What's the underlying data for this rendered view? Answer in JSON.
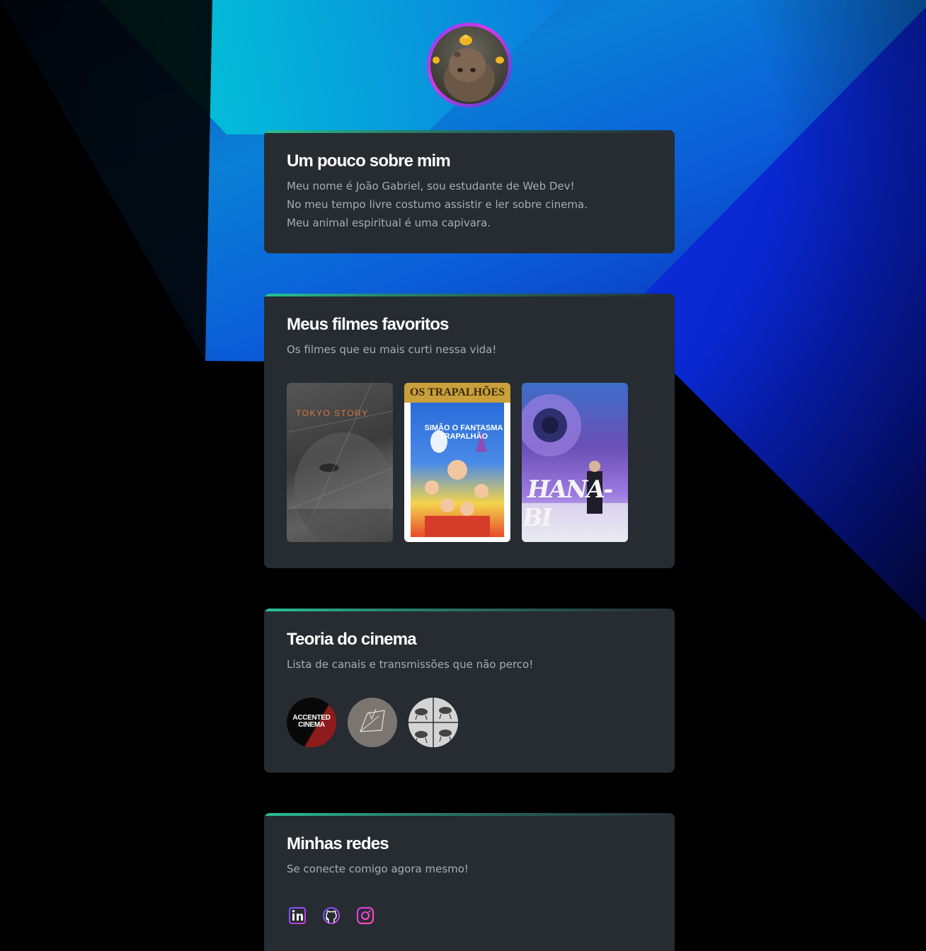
{
  "profile": {
    "avatar_icon": "capybara-avatar"
  },
  "about": {
    "title": "Um pouco sobre mim",
    "lines": [
      "Meu nome é João Gabriel, sou estudante de Web Dev!",
      "No meu tempo livre costumo assistir e ler sobre cinema.",
      "Meu animal espiritual é uma capivara."
    ]
  },
  "movies": {
    "title": "Meus filmes favoritos",
    "subtitle": "Os filmes que eu mais curti nessa vida!",
    "posters": [
      {
        "title_text": "TOKYO STORY"
      },
      {
        "title_text": "OS TRAPALHÕES",
        "sub_text": "SIMÃO O FANTASMA TRAPALHÃO"
      },
      {
        "title_text": "HANA-BI"
      }
    ]
  },
  "cinema": {
    "title": "Teoria do cinema",
    "subtitle": "Lista de canais e transmissões que não perco!",
    "channels": [
      {
        "icon": "accented-cinema-logo",
        "text": "ACCENTED CINEMA"
      },
      {
        "icon": "paper-logo"
      },
      {
        "icon": "horse-motion-logo"
      }
    ]
  },
  "social": {
    "title": "Minhas redes",
    "subtitle": "Se conecte comigo agora mesmo!",
    "icons": [
      "linkedin-icon",
      "github-icon",
      "instagram-icon"
    ]
  },
  "colors": {
    "background": "#000000",
    "card": "#262c31",
    "accent": "#28c197",
    "text_muted": "#a8adb2"
  }
}
